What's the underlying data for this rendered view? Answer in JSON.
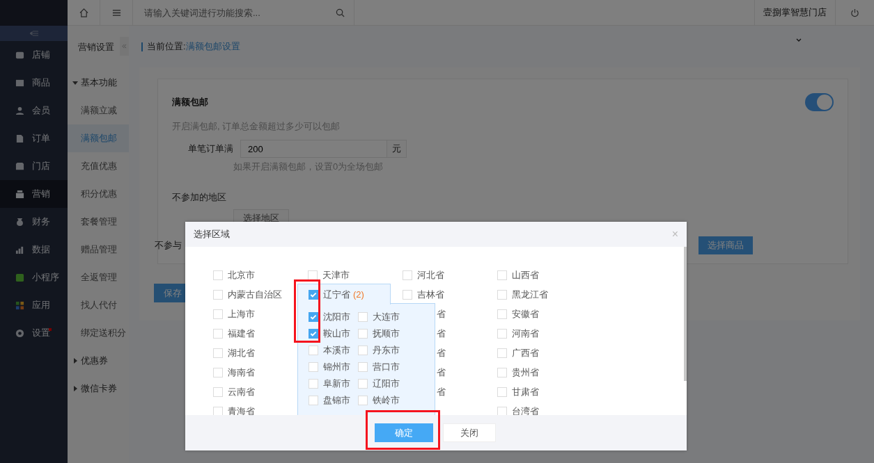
{
  "topbar": {
    "search": {
      "placeholder": "请输入关键词进行功能搜索..."
    },
    "store_name": "壹捌掌智慧门店"
  },
  "nav": [
    {
      "label": "店铺",
      "selected": false,
      "badge": false
    },
    {
      "label": "商品",
      "selected": false,
      "badge": false
    },
    {
      "label": "会员",
      "selected": false,
      "badge": false
    },
    {
      "label": "订单",
      "selected": false,
      "badge": false
    },
    {
      "label": "门店",
      "selected": false,
      "badge": false
    },
    {
      "label": "营销",
      "selected": true,
      "badge": false
    },
    {
      "label": "财务",
      "selected": false,
      "badge": false
    },
    {
      "label": "数据",
      "selected": false,
      "badge": false
    },
    {
      "label": "小程序",
      "selected": false,
      "badge": false
    },
    {
      "label": "应用",
      "selected": false,
      "badge": false
    },
    {
      "label": "设置",
      "selected": false,
      "badge": true
    }
  ],
  "subnav": {
    "title": "营销设置",
    "groups": [
      {
        "label": "基本功能",
        "expanded": true,
        "children": [
          {
            "label": "满额立减",
            "selected": false
          },
          {
            "label": "满额包邮",
            "selected": true
          },
          {
            "label": "充值优惠",
            "selected": false
          },
          {
            "label": "积分优惠",
            "selected": false
          },
          {
            "label": "套餐管理",
            "selected": false
          },
          {
            "label": "赠品管理",
            "selected": false
          },
          {
            "label": "全返管理",
            "selected": false
          },
          {
            "label": "找人代付",
            "selected": false
          },
          {
            "label": "绑定送积分",
            "selected": false
          }
        ]
      },
      {
        "label": "优惠券",
        "expanded": false
      },
      {
        "label": "微信卡券",
        "expanded": false
      }
    ]
  },
  "breadcrumb": {
    "label": "当前位置:",
    "link": "满额包邮设置"
  },
  "settings": {
    "title": "满额包邮",
    "enabled": true,
    "description": "开启满包邮, 订单总金额超过多少可以包邮",
    "order_min": {
      "label": "单笔订单满",
      "value": "200",
      "unit": "元",
      "hint": "如果开启满额包邮，设置0为全场包邮"
    },
    "excluded_regions": {
      "label": "不参加的地区",
      "button": "选择地区"
    },
    "excluded_products": {
      "label": "不参与",
      "button": "选择商品"
    },
    "save_button": "保存"
  },
  "dialog": {
    "title": "选择区域",
    "close": "×",
    "columns": [
      {
        "items": [
          {
            "kind": "province",
            "label": "北京市",
            "checked": false
          },
          {
            "kind": "province",
            "label": "内蒙古自治区",
            "checked": false
          },
          {
            "kind": "province",
            "label": "上海市",
            "checked": false
          },
          {
            "kind": "province",
            "label": "福建省",
            "checked": false
          },
          {
            "kind": "province",
            "label": "湖北省",
            "checked": false
          },
          {
            "kind": "province",
            "label": "海南省",
            "checked": false
          },
          {
            "kind": "province",
            "label": "云南省",
            "checked": false
          },
          {
            "kind": "province",
            "label": "青海省",
            "checked": false
          }
        ]
      },
      {
        "items": [
          {
            "kind": "province",
            "label": "天津市",
            "checked": false
          },
          {
            "kind": "expanded",
            "label": "辽宁省",
            "count": "(2)",
            "checked": true,
            "cities": [
              {
                "label": "沈阳市",
                "checked": true
              },
              {
                "label": "大连市",
                "checked": false
              },
              {
                "label": "鞍山市",
                "checked": true
              },
              {
                "label": "抚顺市",
                "checked": false
              },
              {
                "label": "本溪市",
                "checked": false
              },
              {
                "label": "丹东市",
                "checked": false
              },
              {
                "label": "锦州市",
                "checked": false
              },
              {
                "label": "营口市",
                "checked": false
              },
              {
                "label": "阜新市",
                "checked": false
              },
              {
                "label": "辽阳市",
                "checked": false
              },
              {
                "label": "盘锦市",
                "checked": false
              },
              {
                "label": "铁岭市",
                "checked": false
              }
            ]
          }
        ]
      },
      {
        "items": [
          {
            "kind": "province",
            "label": "河北省",
            "checked": false
          },
          {
            "kind": "province",
            "label": "吉林省",
            "checked": false
          },
          {
            "kind": "clipped",
            "label": "省"
          },
          {
            "kind": "clipped",
            "label": "省"
          },
          {
            "kind": "clipped",
            "label": "省"
          },
          {
            "kind": "clipped",
            "label": "省"
          },
          {
            "kind": "clipped",
            "label": "省"
          }
        ]
      },
      {
        "items": [
          {
            "kind": "province",
            "label": "山西省",
            "checked": false
          },
          {
            "kind": "province",
            "label": "黑龙江省",
            "checked": false
          },
          {
            "kind": "province",
            "label": "安徽省",
            "checked": false
          },
          {
            "kind": "province",
            "label": "河南省",
            "checked": false
          },
          {
            "kind": "province",
            "label": "广西省",
            "checked": false
          },
          {
            "kind": "province",
            "label": "贵州省",
            "checked": false
          },
          {
            "kind": "province",
            "label": "甘肃省",
            "checked": false
          },
          {
            "kind": "province",
            "label": "台湾省",
            "checked": false
          }
        ]
      }
    ],
    "buttons": [
      {
        "kind": "primary",
        "label": "确定"
      },
      {
        "kind": "default",
        "label": "关闭"
      }
    ]
  }
}
